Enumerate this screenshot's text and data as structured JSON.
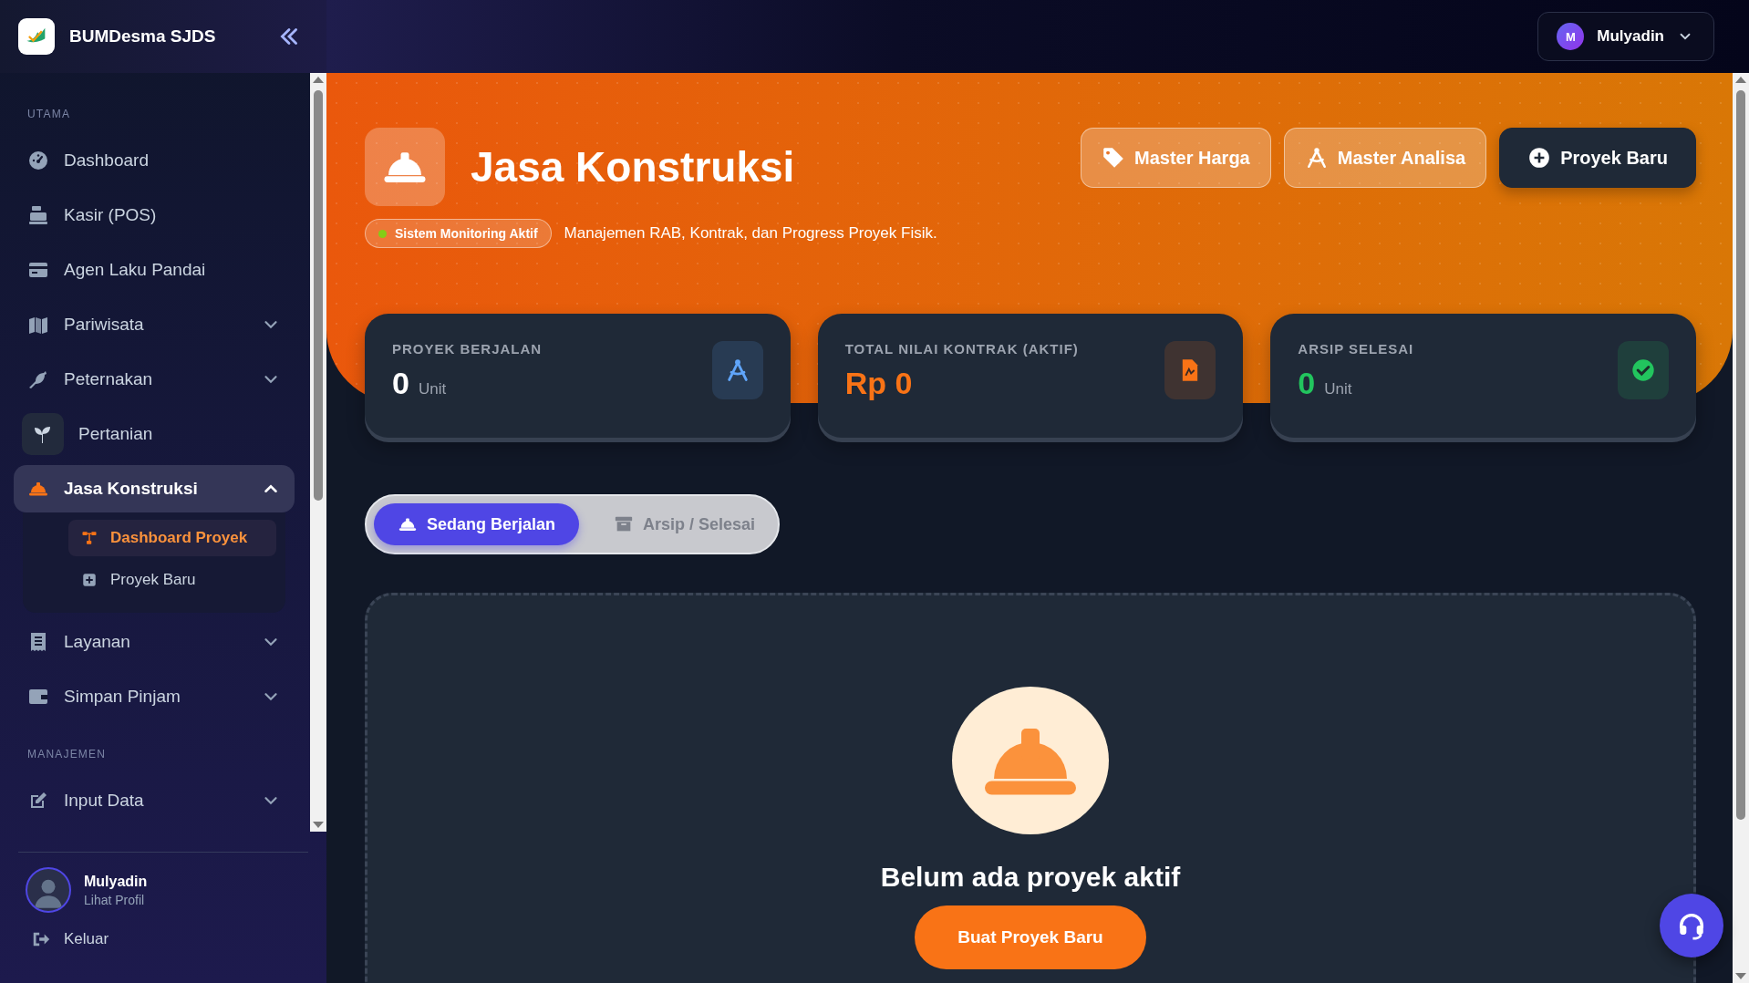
{
  "brand": {
    "name": "BUMDesma SJDS"
  },
  "sidebar": {
    "sections": [
      {
        "title": "UTAMA",
        "items": [
          {
            "label": "Dashboard",
            "selected": false,
            "hovered": false
          },
          {
            "label": "Kasir (POS)",
            "selected": false,
            "hovered": false
          },
          {
            "label": "Agen Laku Pandai",
            "selected": false,
            "hovered": false
          },
          {
            "label": "Pariwisata",
            "selected": false,
            "hovered": false,
            "expanded": false
          },
          {
            "label": "Peternakan",
            "selected": false,
            "hovered": false,
            "expanded": false
          },
          {
            "label": "Pertanian",
            "selected": false,
            "hovered": true
          },
          {
            "label": "Jasa Konstruksi",
            "selected": true,
            "hovered": false,
            "expanded": true,
            "children": [
              {
                "label": "Dashboard Proyek",
                "selected": true
              },
              {
                "label": "Proyek Baru",
                "selected": false
              }
            ]
          },
          {
            "label": "Layanan",
            "selected": false,
            "hovered": false,
            "expanded": false
          },
          {
            "label": "Simpan Pinjam",
            "selected": false,
            "hovered": false,
            "expanded": false
          }
        ]
      },
      {
        "title": "MANAJEMEN",
        "items": [
          {
            "label": "Input Data",
            "selected": false,
            "hovered": false,
            "expanded": false
          }
        ]
      }
    ]
  },
  "profile": {
    "name": "Mulyadin",
    "link": "Lihat Profil",
    "logout": "Keluar"
  },
  "topbar": {
    "user": {
      "initial": "M",
      "name": "Mulyadin"
    }
  },
  "hero": {
    "title": "Jasa Konstruksi",
    "status": {
      "label": "Sistem Monitoring Aktif",
      "active": true
    },
    "description": "Manajemen RAB, Kontrak, dan Progress Proyek Fisik.",
    "buttons": [
      {
        "label": "Master Harga",
        "primary": false
      },
      {
        "label": "Master Analisa",
        "primary": false
      },
      {
        "label": "Proyek Baru",
        "primary": true
      }
    ]
  },
  "stats": [
    {
      "label": "PROYEK BERJALAN",
      "value": "0",
      "unit": "Unit",
      "color": "#60a5fa",
      "highlight": false
    },
    {
      "label": "TOTAL NILAI KONTRAK (AKTIF)",
      "value": "Rp 0",
      "color": "#f97316",
      "highlight": true
    },
    {
      "label": "ARSIP SELESAI",
      "value": "0",
      "unit": "Unit",
      "color": "#22c55e",
      "highlight": true
    }
  ],
  "tabs": [
    {
      "label": "Sedang Berjalan",
      "selected": true
    },
    {
      "label": "Arsip / Selesai",
      "selected": false
    }
  ],
  "empty": {
    "title": "Belum ada proyek aktif",
    "button": "Buat Proyek Baru"
  }
}
